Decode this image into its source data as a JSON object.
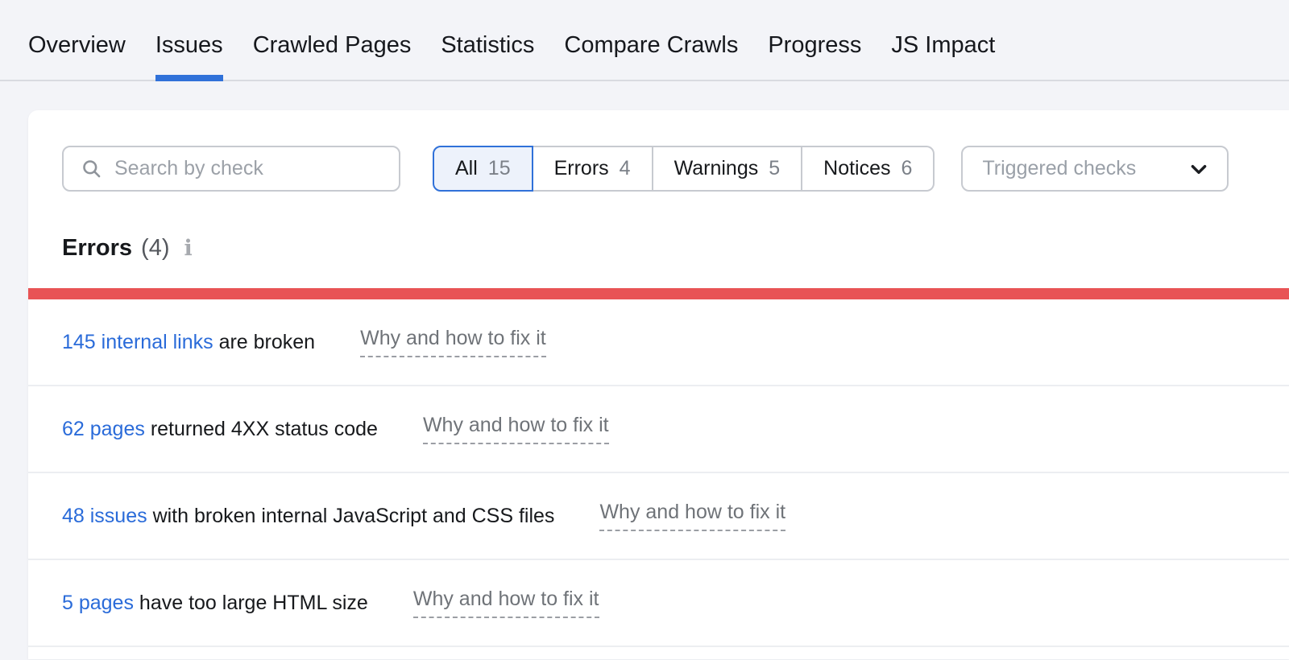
{
  "nav": {
    "tabs": [
      {
        "label": "Overview"
      },
      {
        "label": "Issues"
      },
      {
        "label": "Crawled Pages"
      },
      {
        "label": "Statistics"
      },
      {
        "label": "Compare Crawls"
      },
      {
        "label": "Progress"
      },
      {
        "label": "JS Impact"
      }
    ]
  },
  "toolbar": {
    "search_placeholder": "Search by check",
    "filters": [
      {
        "label": "All",
        "count": "15"
      },
      {
        "label": "Errors",
        "count": "4"
      },
      {
        "label": "Warnings",
        "count": "5"
      },
      {
        "label": "Notices",
        "count": "6"
      }
    ],
    "dropdown_label": "Triggered checks"
  },
  "section": {
    "title": "Errors",
    "count": "(4)"
  },
  "issues": [
    {
      "link": "145 internal links",
      "text": " are broken",
      "help": "Why and how to fix it"
    },
    {
      "link": "62 pages",
      "text": " returned 4XX status code",
      "help": "Why and how to fix it"
    },
    {
      "link": "48 issues",
      "text": " with broken internal JavaScript and CSS files",
      "help": "Why and how to fix it"
    },
    {
      "link": "5 pages",
      "text": " have too large HTML size",
      "help": "Why and how to fix it"
    }
  ],
  "colors": {
    "accent_blue": "#3071d9",
    "link_blue": "#2a6bd9",
    "error_red": "#e85355",
    "page_bg": "#f3f4f8",
    "muted_gray": "#9aa0a8"
  }
}
